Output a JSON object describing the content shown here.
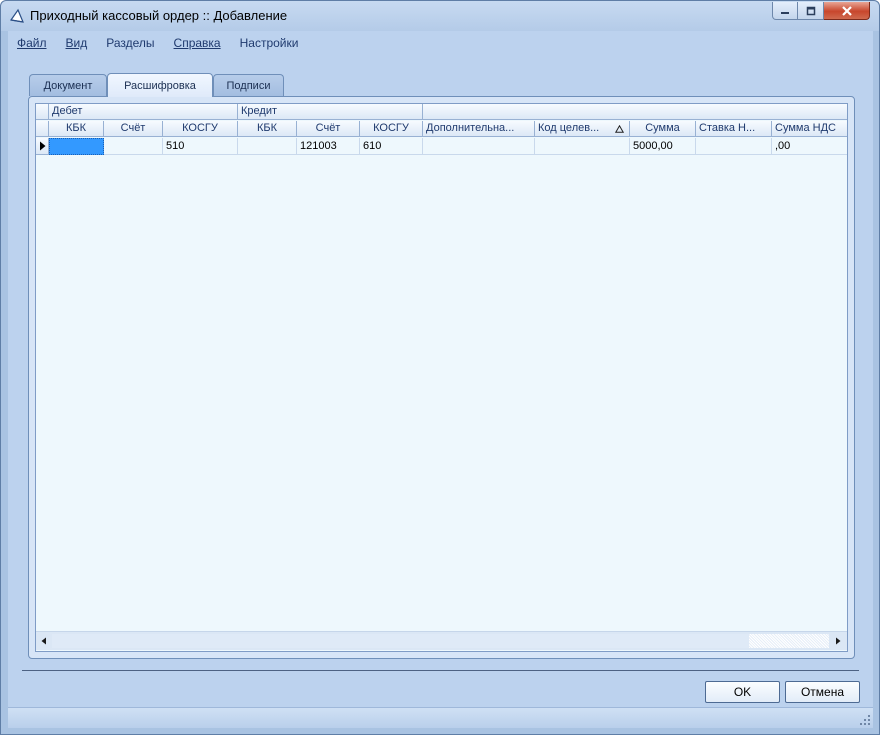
{
  "window": {
    "title": "Приходный кассовый ордер :: Добавление"
  },
  "menu": [
    {
      "label": "Файл",
      "underline": true
    },
    {
      "label": "Вид",
      "underline": true
    },
    {
      "label": "Разделы",
      "underline": false
    },
    {
      "label": "Справка",
      "underline": true
    },
    {
      "label": "Настройки",
      "underline": false
    }
  ],
  "tabs": [
    {
      "label": "Документ",
      "active": false
    },
    {
      "label": "Расшифровка",
      "active": true
    },
    {
      "label": "Подписи",
      "active": false
    }
  ],
  "grid": {
    "groups": [
      "Дебет",
      "Кредит",
      ""
    ],
    "columns": [
      "КБК",
      "Счёт",
      "КОСГУ",
      "КБК",
      "Счёт",
      "КОСГУ",
      "Дополнительна...",
      "Код целев...",
      "Сумма",
      "Ставка Н...",
      "Сумма НДС"
    ],
    "sorted_column_index": 7,
    "sort_icon": "triangle-up-icon",
    "rows": [
      [
        "",
        "",
        "510",
        "",
        "121003",
        "610",
        "",
        "",
        "5000,00",
        "",
        ",00"
      ]
    ]
  },
  "buttons": {
    "ok": "OK",
    "cancel": "Отмена"
  },
  "colors": {
    "window_bg": "#bcd2ee",
    "grid_bg": "#eef8fd",
    "selection": "#3399ff",
    "close_button": "#c8462c"
  }
}
